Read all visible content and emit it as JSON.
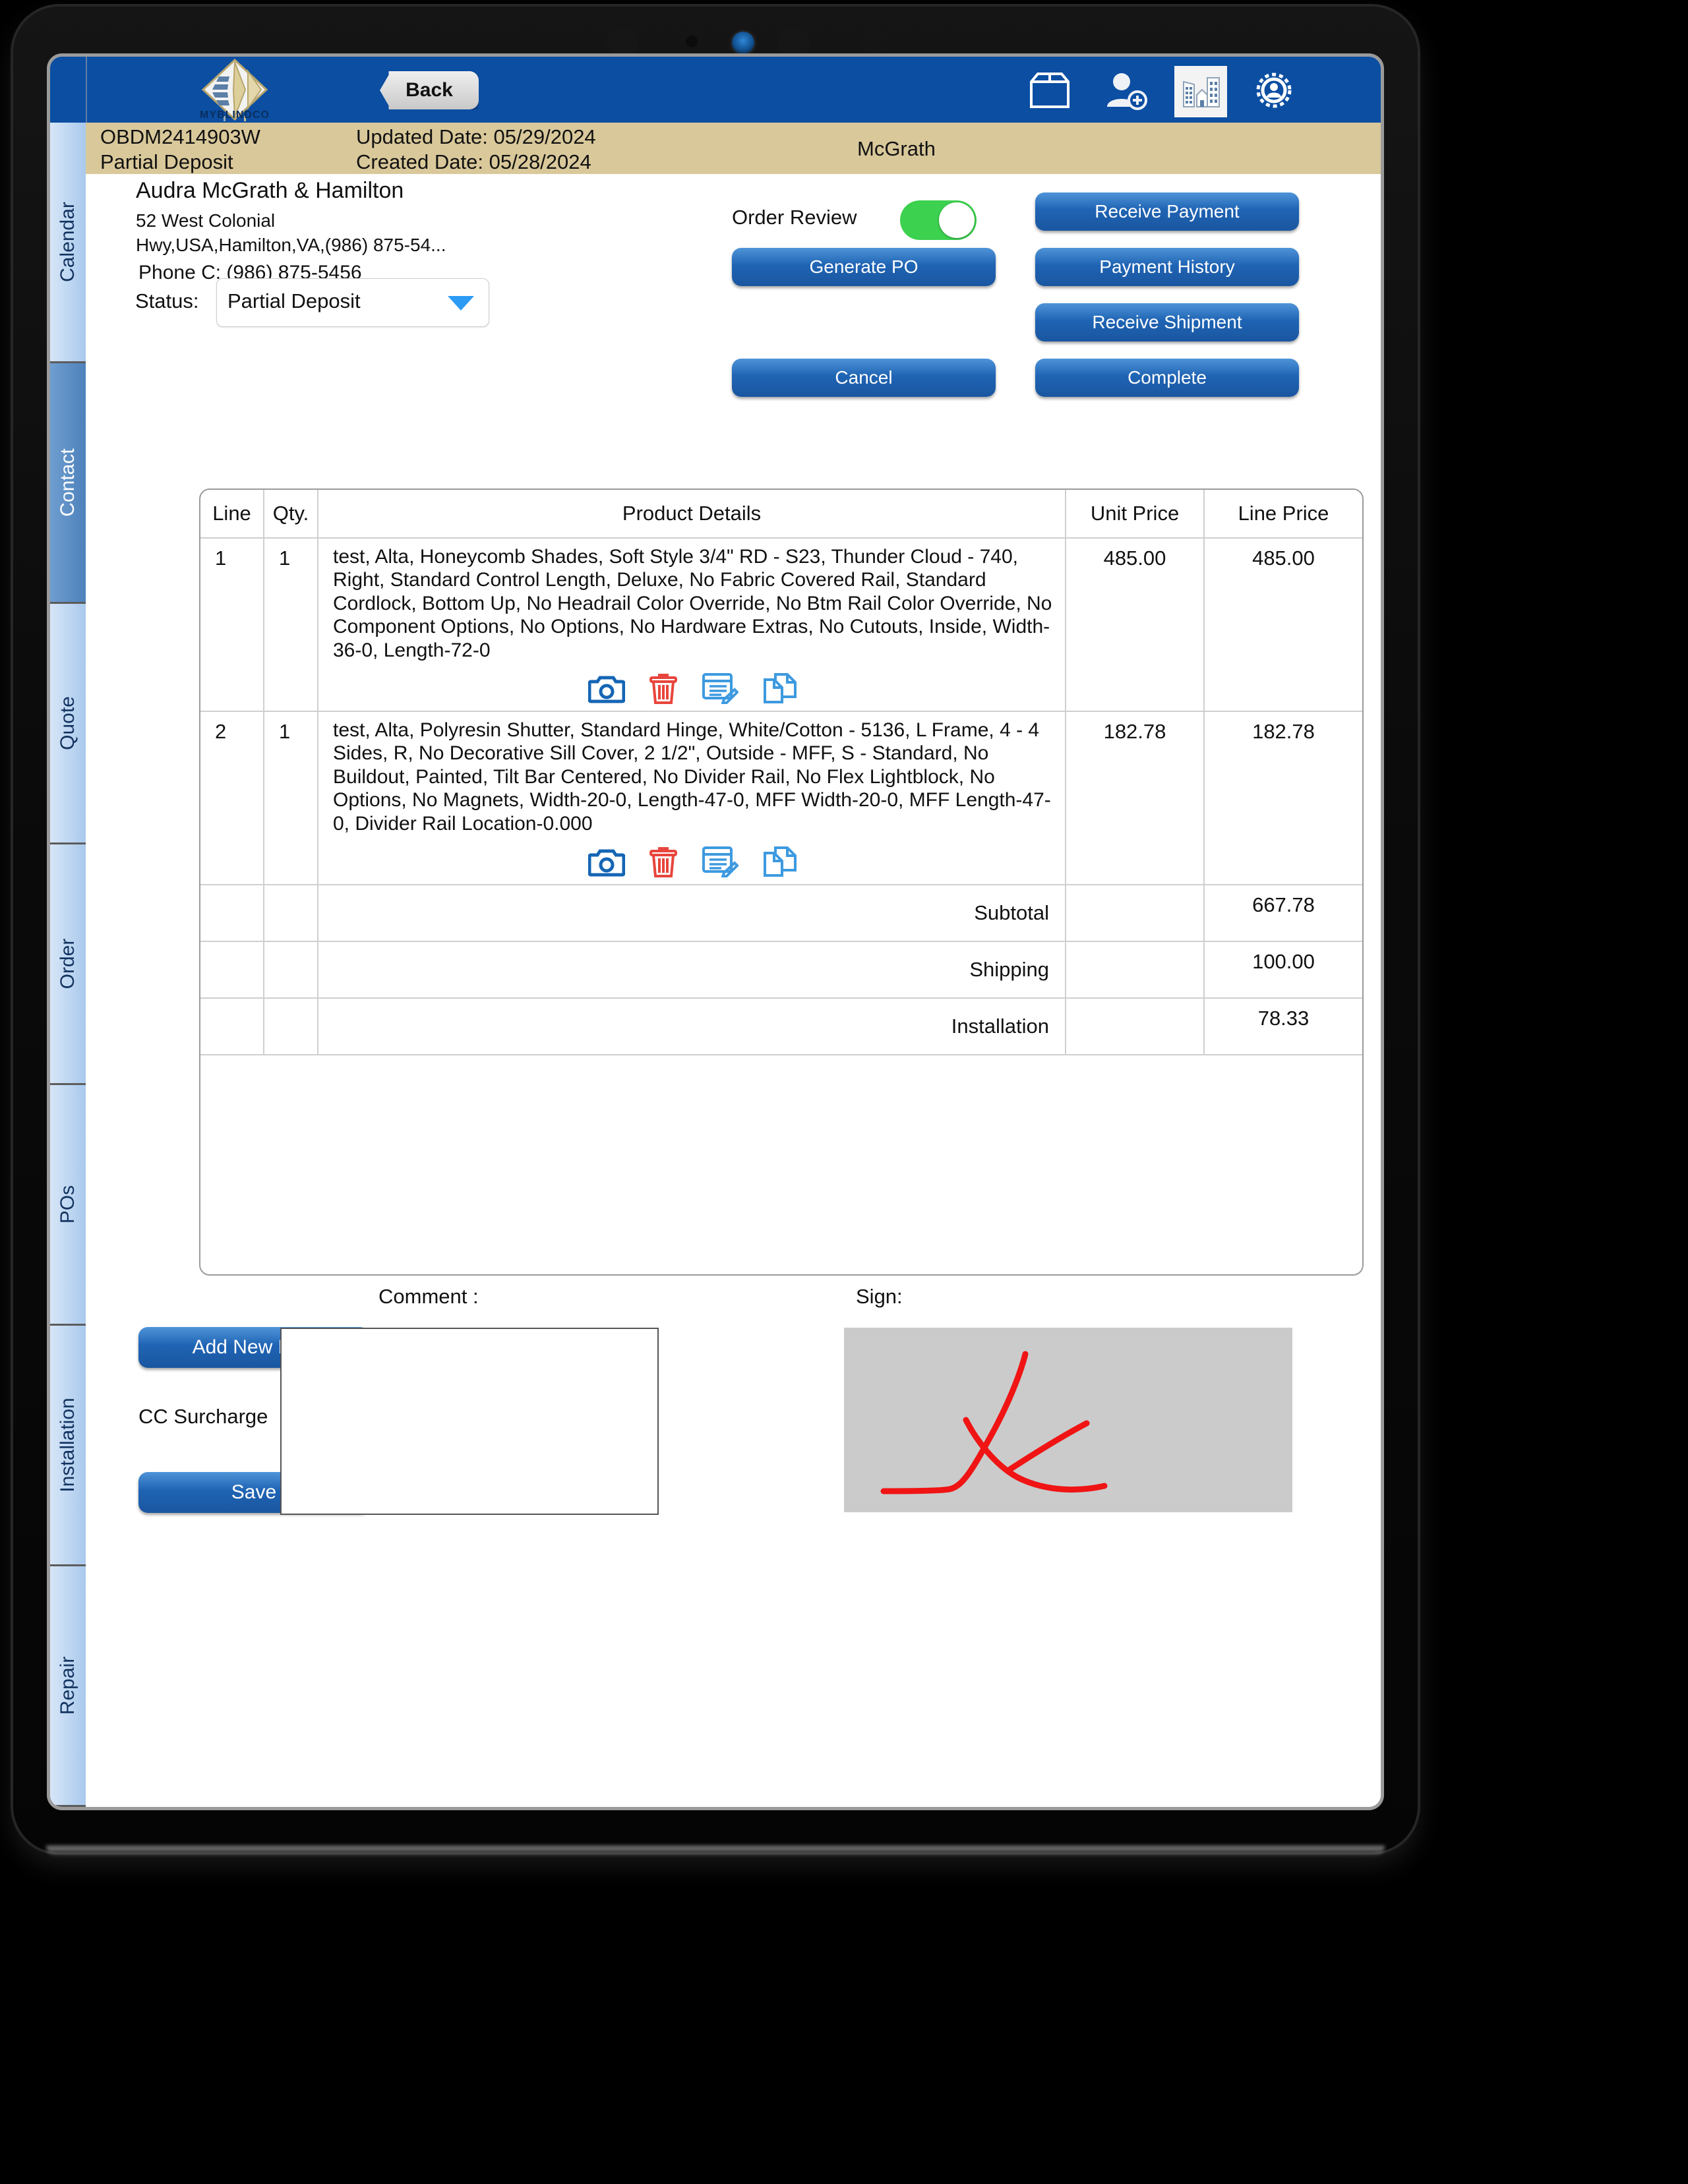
{
  "appbar": {
    "logo_text": "MYBLINDCO",
    "back_label": "Back",
    "icons": [
      {
        "name": "box-icon",
        "label": "Inventory"
      },
      {
        "name": "add-user-icon",
        "label": "Add Customer"
      },
      {
        "name": "buildings-icon",
        "label": "Company"
      },
      {
        "name": "gear-user-icon",
        "label": "Settings"
      }
    ]
  },
  "rail": {
    "items": [
      {
        "label": "Calendar",
        "active": false
      },
      {
        "label": "Contact",
        "active": true
      },
      {
        "label": "Quote",
        "active": false
      },
      {
        "label": "Order",
        "active": false
      },
      {
        "label": "POs",
        "active": false
      },
      {
        "label": "Installation",
        "active": false
      },
      {
        "label": "Repair",
        "active": false
      }
    ]
  },
  "band": {
    "order_number": "OBDM2414903W",
    "order_status": "Partial Deposit",
    "updated_date": "Updated Date: 05/29/2024",
    "created_date": "Created Date: 05/28/2024",
    "account": "McGrath"
  },
  "customer": {
    "name": "Audra McGrath & Hamilton",
    "address_line1": "52 West Colonial",
    "address_line2": "Hwy,USA,Hamilton,VA,(986) 875-54...",
    "phone": "Phone C:  (986) 875-5456",
    "status_label": "Status:",
    "status_value": "Partial Deposit"
  },
  "actions": {
    "order_review_label": "Order Review",
    "order_review_on": true,
    "receive_payment": "Receive Payment",
    "generate_po": "Generate PO",
    "payment_history": "Payment History",
    "receive_shipment": "Receive Shipment",
    "cancel": "Cancel",
    "complete": "Complete"
  },
  "table": {
    "columns": [
      "Line",
      "Qty.",
      "Product Details",
      "Unit Price",
      "Line Price"
    ],
    "rows": [
      {
        "line": "1",
        "qty": "1",
        "details": "test, Alta, Honeycomb Shades, Soft Style 3/4\" RD - S23, Thunder Cloud - 740, Right, Standard Control Length, Deluxe, No Fabric Covered Rail, Standard Cordlock, Bottom Up, No Headrail Color Override, No Btm Rail Color Override, No Component Options, No Options, No Hardware Extras, No Cutouts, Inside, Width-36-0, Length-72-0",
        "unit_price": "485.00",
        "line_price": "485.00"
      },
      {
        "line": "2",
        "qty": "1",
        "details": "test, Alta, Polyresin Shutter, Standard Hinge, White/Cotton - 5136, L Frame, 4 - 4 Sides, R, No Decorative Sill Cover, 2 1/2\", Outside - MFF, S - Standard, No Buildout, Painted, Tilt Bar Centered, No Divider Rail, No Flex Lightblock, No Options, No Magnets, Width-20-0, Length-47-0, MFF Width-20-0, MFF Length-47-0, Divider Rail Location-0.000",
        "unit_price": "182.78",
        "line_price": "182.78"
      }
    ],
    "row_actions": [
      "camera-icon",
      "trash-icon",
      "edit-note-icon",
      "duplicate-icon"
    ],
    "totals": [
      {
        "label": "Subtotal",
        "value": "667.78"
      },
      {
        "label": "Shipping",
        "value": "100.00"
      },
      {
        "label": "Installation",
        "value": "78.33"
      }
    ]
  },
  "bottom": {
    "add_new_line": "Add New Line",
    "cc_surcharge_label": "CC Surcharge",
    "cc_surcharge_on": true,
    "save": "Save",
    "comment_label": "Comment :",
    "comment_value": "",
    "comment_placeholder": "",
    "sign_label": "Sign:"
  },
  "colors": {
    "appbar_blue": "#0b4ea2",
    "band_tan": "#d9c89a",
    "button_blue": "#1f64b4",
    "toggle_green": "#3cd14f",
    "trash_red": "#e8453c",
    "signature_red": "#f01414",
    "rail_light": "#a9c9ec",
    "rail_active": "#4d81bb"
  }
}
